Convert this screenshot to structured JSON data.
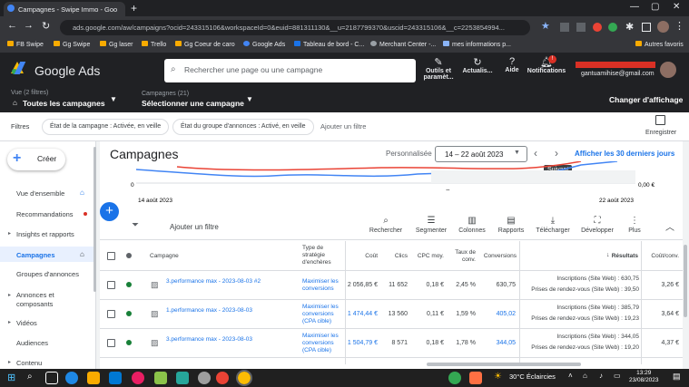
{
  "browser": {
    "tab_title": "Campagnes - Swipe Immo - Goo",
    "new_tab": "+",
    "url": "ads.google.com/aw/campaigns?ocid=243315106&workspaceId=0&euid=881311130&__u=2187799370&uscid=243315106&__c=2253854994...",
    "bookmarks": [
      "FB Swipe",
      "Gg Swipe",
      "Gg laser",
      "Trello",
      "Gg Coeur de caro",
      "Google Ads",
      "Tableau de bord - C...",
      "Merchant Center -...",
      "mes informations p..."
    ],
    "other_bookmarks": "Autres favoris"
  },
  "ads_header": {
    "product": "Google Ads",
    "search_placeholder": "Rechercher une page ou une campagne",
    "buttons": {
      "tools": "Outils et paramèt...",
      "refresh": "Actualis...",
      "help": "Aide",
      "notifications": "Notifications"
    },
    "notification_badge": "!",
    "account_email": "gantuamihise@gmail.com"
  },
  "subheader": {
    "view_label": "Vue (2 filtres)",
    "view_value": "Toutes les campagnes",
    "campaigns_label": "Campagnes (21)",
    "campaigns_value": "Sélectionner une campagne",
    "change_view": "Changer d'affichage"
  },
  "filters": {
    "label": "Filtres",
    "chips": [
      "État de la campagne : Activée, en veille",
      "État du groupe d'annonces : Activé, en veille"
    ],
    "add_filter": "Ajouter un filtre",
    "save": "Enregistrer"
  },
  "sidebar": {
    "create": "Créer",
    "items": [
      "Vue d'ensemble",
      "Recommandations",
      "Insights et rapports",
      "Campagnes",
      "Groupes d'annonces",
      "Annonces et composants",
      "Vidéos",
      "Audiences",
      "Contenu"
    ]
  },
  "main": {
    "title": "Campagnes",
    "custom_label": "Personnalisée",
    "date_range": "14 – 22 août 2023",
    "last_30": "Afficher les 30 derniers jours",
    "tooltip": "Suivant",
    "add_filter": "Ajouter un filtre",
    "toolbar": [
      "Rechercher",
      "Segmenter",
      "Colonnes",
      "Rapports",
      "Télécharger",
      "Développer",
      "Plus"
    ]
  },
  "chart_data": {
    "type": "line",
    "x": [
      "14 août 2023",
      "22 août 2023"
    ],
    "y_left_tick": "0",
    "y_right_tick": "0,00 €",
    "colors": {
      "series1": "#4285f4",
      "series2": "#ea4335"
    }
  },
  "table": {
    "headers": {
      "campaign": "Campagne",
      "strategy": "Type de stratégie d'enchères",
      "cost": "Coût",
      "clicks": "Clics",
      "cpc": "CPC moy.",
      "conv_rate": "Taux de conv.",
      "conversions": "Conversions",
      "results": "Résultats",
      "cost_conv": "Coût/conv."
    },
    "rows": [
      {
        "name": "3.performance max - 2023-08-03 #2",
        "strategy": "Maximiser les conversions",
        "cost": "2 056,85 €",
        "clicks": "11 652",
        "cpc": "0,18 €",
        "conv_rate": "2,45 %",
        "conversions": "630,75",
        "result1": "Inscriptions (Site Web) : 630,75",
        "result2": "Prises de rendez-vous (Site Web) : 39,50",
        "cost_conv": "3,26 €"
      },
      {
        "name": "1.performance max - 2023-08-03",
        "strategy": "Maximiser les conversions (CPA cible)",
        "cost": "1 474,44 €",
        "clicks": "13 560",
        "cpc": "0,11 €",
        "conv_rate": "1,59 %",
        "conversions": "405,02",
        "result1": "Inscriptions (Site Web) : 385,79",
        "result2": "Prises de rendez-vous (Site Web) : 19,23",
        "cost_conv": "3,64 €"
      },
      {
        "name": "3.performance max - 2023-08-03",
        "strategy": "Maximiser les conversions (CPA cible)",
        "cost": "1 504,79 €",
        "clicks": "8 571",
        "cpc": "0,18 €",
        "conv_rate": "1,78 %",
        "conversions": "344,05",
        "result1": "Inscriptions (Site Web) : 344,05",
        "result2": "Prises de rendez-vous (Site Web) : 19,20",
        "cost_conv": "4,37 €"
      }
    ]
  },
  "taskbar": {
    "weather": "30°C Éclaircies",
    "time": "13:29",
    "date": "23/08/2023"
  }
}
